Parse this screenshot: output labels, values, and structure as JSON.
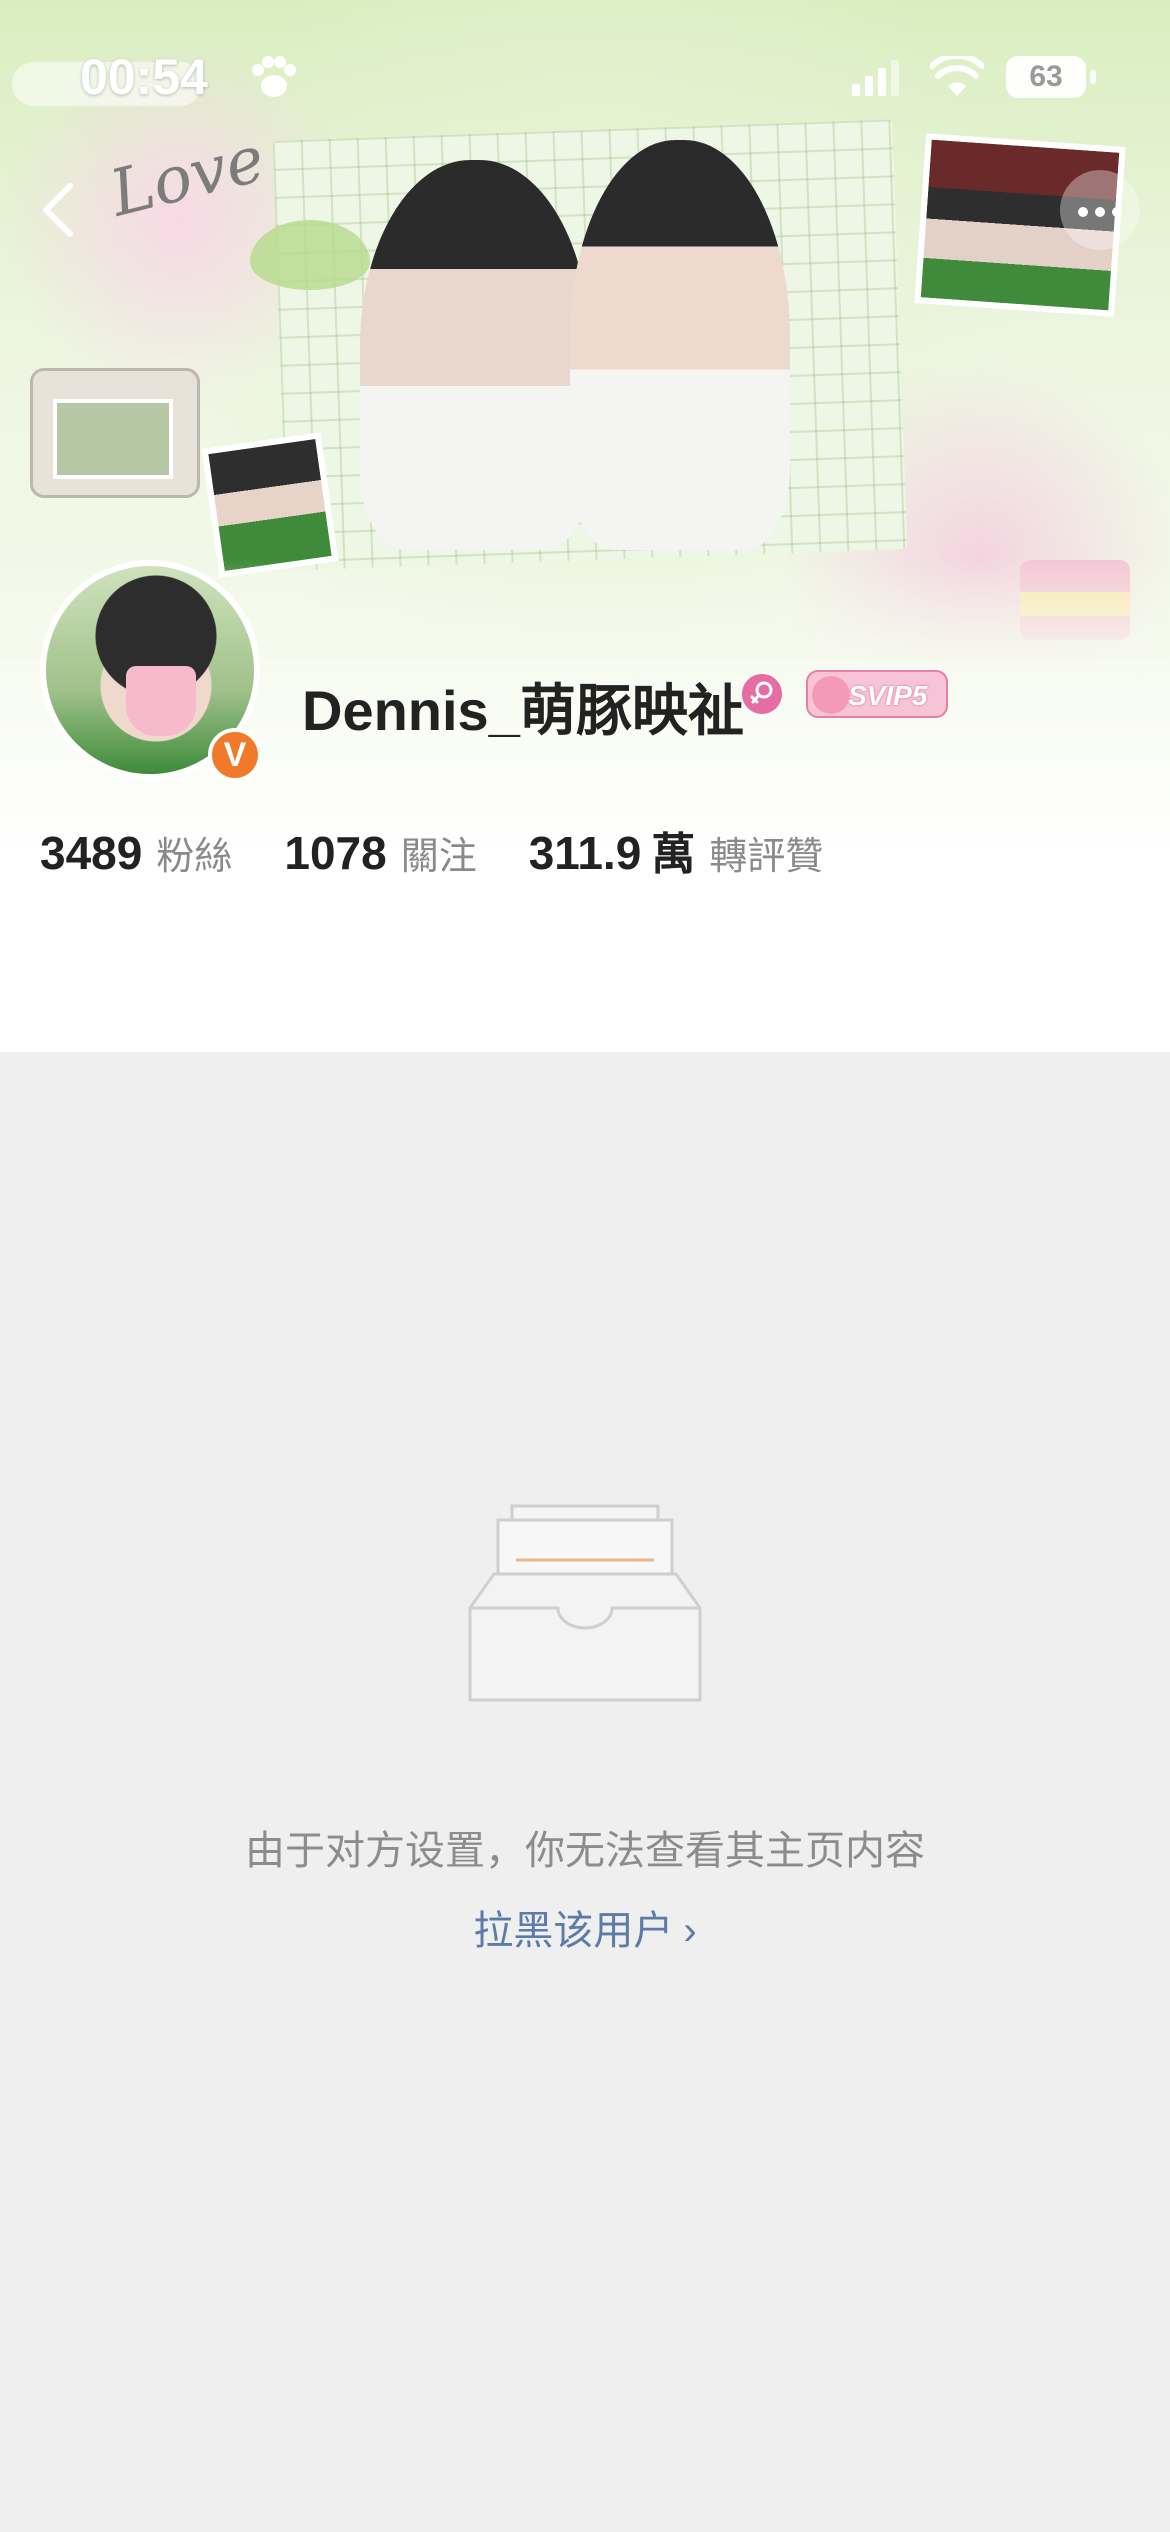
{
  "status_bar": {
    "time": "00:54",
    "battery": "63"
  },
  "profile": {
    "username": "Dennis_萌豚映祉",
    "svip_label": "SVIP5",
    "verified_label": "V"
  },
  "stats": [
    {
      "value": "3489",
      "unit": "",
      "label": "粉絲"
    },
    {
      "value": "1078",
      "unit": "",
      "label": "關注"
    },
    {
      "value": "311.9",
      "unit": "萬",
      "label": "轉評贊"
    }
  ],
  "cover": {
    "love_text": "Love"
  },
  "empty_state": {
    "message": "由于对方设置，你无法查看其主页内容",
    "block_link": "拉黑该用户",
    "chevron": "›"
  },
  "icons": {
    "back": "back-arrow-icon",
    "more": "more-dots-icon",
    "paw": "paw-icon",
    "signal": "signal-icon",
    "wifi": "wifi-icon",
    "gender": "female-icon",
    "empty": "empty-inbox-icon"
  },
  "colors": {
    "verified": "#f07a2a",
    "link": "#5b7ca8",
    "background": "#efefef"
  }
}
